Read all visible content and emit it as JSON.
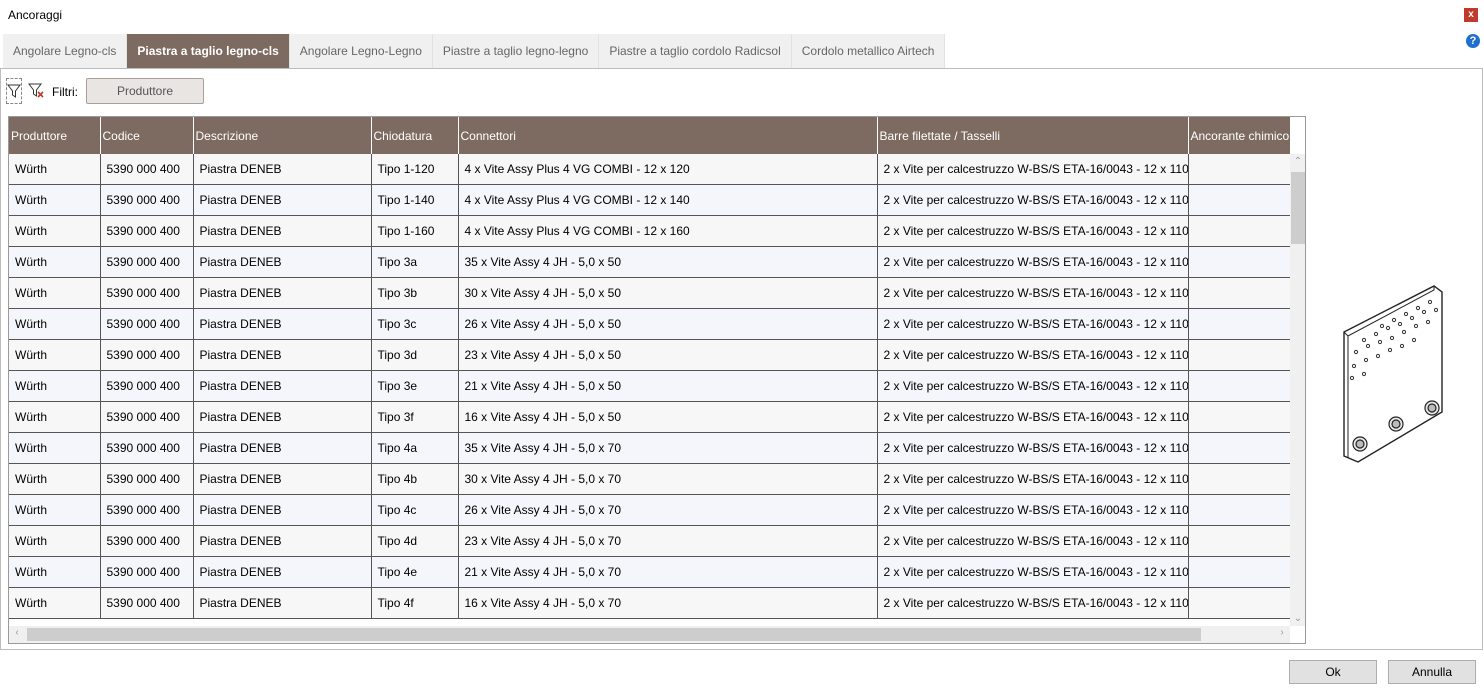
{
  "window": {
    "title": "Ancoraggi",
    "close_glyph": "x",
    "help_glyph": "?"
  },
  "tabs": [
    {
      "label": "Angolare Legno-cls",
      "active": false
    },
    {
      "label": "Piastra a taglio legno-cls",
      "active": true
    },
    {
      "label": "Angolare Legno-Legno",
      "active": false
    },
    {
      "label": "Piastre a taglio legno-legno",
      "active": false
    },
    {
      "label": "Piastre a taglio cordolo Radicsol",
      "active": false
    },
    {
      "label": "Cordolo metallico Airtech",
      "active": false
    }
  ],
  "filters": {
    "label": "Filtri:",
    "button_label": "Produttore"
  },
  "table": {
    "columns": [
      "Produttore",
      "Codice",
      "Descrizione",
      "Chiodatura",
      "Connettori",
      "Barre filettate / Tasselli",
      "Ancorante chimico"
    ],
    "rows": [
      [
        "Würth",
        "5390 000 400",
        "Piastra DENEB",
        "Tipo 1-120",
        "4 x Vite Assy Plus 4 VG COMBI - 12 x 120",
        "2 x Vite per calcestruzzo W-BS/S ETA-16/0043 - 12 x 110",
        ""
      ],
      [
        "Würth",
        "5390 000 400",
        "Piastra DENEB",
        "Tipo 1-140",
        "4 x Vite Assy Plus 4 VG COMBI - 12 x 140",
        "2 x Vite per calcestruzzo W-BS/S ETA-16/0043 - 12 x 110",
        ""
      ],
      [
        "Würth",
        "5390 000 400",
        "Piastra DENEB",
        "Tipo 1-160",
        "4 x Vite Assy Plus 4 VG COMBI - 12 x 160",
        "2 x Vite per calcestruzzo W-BS/S ETA-16/0043 - 12 x 110",
        ""
      ],
      [
        "Würth",
        "5390 000 400",
        "Piastra DENEB",
        "Tipo 3a",
        "35 x Vite Assy 4 JH - 5,0 x 50",
        "2 x Vite per calcestruzzo W-BS/S ETA-16/0043 - 12 x 110",
        ""
      ],
      [
        "Würth",
        "5390 000 400",
        "Piastra DENEB",
        "Tipo 3b",
        "30 x Vite Assy 4 JH - 5,0 x 50",
        "2 x Vite per calcestruzzo W-BS/S ETA-16/0043 - 12 x 110",
        ""
      ],
      [
        "Würth",
        "5390 000 400",
        "Piastra DENEB",
        "Tipo 3c",
        "26 x Vite Assy 4 JH - 5,0 x 50",
        "2 x Vite per calcestruzzo W-BS/S ETA-16/0043 - 12 x 110",
        ""
      ],
      [
        "Würth",
        "5390 000 400",
        "Piastra DENEB",
        "Tipo 3d",
        "23 x Vite Assy 4 JH - 5,0 x 50",
        "2 x Vite per calcestruzzo W-BS/S ETA-16/0043 - 12 x 110",
        ""
      ],
      [
        "Würth",
        "5390 000 400",
        "Piastra DENEB",
        "Tipo 3e",
        "21 x Vite Assy 4 JH - 5,0 x 50",
        "2 x Vite per calcestruzzo W-BS/S ETA-16/0043 - 12 x 110",
        ""
      ],
      [
        "Würth",
        "5390 000 400",
        "Piastra DENEB",
        "Tipo 3f",
        "16 x Vite Assy 4 JH - 5,0 x 50",
        "2 x Vite per calcestruzzo W-BS/S ETA-16/0043 - 12 x 110",
        ""
      ],
      [
        "Würth",
        "5390 000 400",
        "Piastra DENEB",
        "Tipo 4a",
        "35 x Vite Assy 4 JH - 5,0 x 70",
        "2 x Vite per calcestruzzo W-BS/S ETA-16/0043 - 12 x 110",
        ""
      ],
      [
        "Würth",
        "5390 000 400",
        "Piastra DENEB",
        "Tipo 4b",
        "30 x Vite Assy 4 JH - 5,0 x 70",
        "2 x Vite per calcestruzzo W-BS/S ETA-16/0043 - 12 x 110",
        ""
      ],
      [
        "Würth",
        "5390 000 400",
        "Piastra DENEB",
        "Tipo 4c",
        "26 x Vite Assy 4 JH - 5,0 x 70",
        "2 x Vite per calcestruzzo W-BS/S ETA-16/0043 - 12 x 110",
        ""
      ],
      [
        "Würth",
        "5390 000 400",
        "Piastra DENEB",
        "Tipo 4d",
        "23 x Vite Assy 4 JH - 5,0 x 70",
        "2 x Vite per calcestruzzo W-BS/S ETA-16/0043 - 12 x 110",
        ""
      ],
      [
        "Würth",
        "5390 000 400",
        "Piastra DENEB",
        "Tipo 4e",
        "21 x Vite Assy 4 JH - 5,0 x 70",
        "2 x Vite per calcestruzzo W-BS/S ETA-16/0043 - 12 x 110",
        ""
      ],
      [
        "Würth",
        "5390 000 400",
        "Piastra DENEB",
        "Tipo 4f",
        "16 x Vite Assy 4 JH - 5,0 x 70",
        "2 x Vite per calcestruzzo W-BS/S ETA-16/0043 - 12 x 110",
        ""
      ]
    ]
  },
  "buttons": {
    "ok": "Ok",
    "cancel": "Annulla"
  },
  "icons": {
    "funnel": "funnel-icon",
    "funnel_clear": "funnel-clear-icon",
    "plate_preview": "plate-preview-icon"
  },
  "colors": {
    "header_bg": "#7d6a60",
    "active_tab_bg": "#7d6a60",
    "close_bg": "#c0392b",
    "help_bg": "#1f6fd1"
  }
}
